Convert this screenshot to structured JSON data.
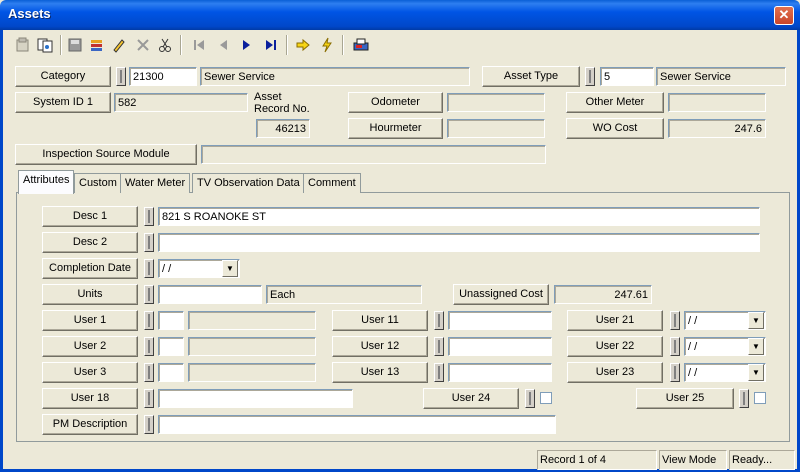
{
  "window": {
    "title": "Assets",
    "close_glyph": "✕"
  },
  "toolbar": {
    "icons": [
      "properties-icon",
      "copy-record-icon",
      "save-icon",
      "stack-icon",
      "edit-pencil-icon",
      "delete-icon",
      "cut-icon",
      "first-record-icon",
      "previous-record-icon",
      "next-record-icon",
      "last-record-icon",
      "goto-arrow-icon",
      "lightning-icon",
      "print-report-icon"
    ]
  },
  "header": {
    "category_label": "Category",
    "category_code": "21300",
    "category_name": "Sewer Service",
    "asset_type_label": "Asset Type",
    "asset_type_code": "5",
    "asset_type_name": "Sewer Service",
    "system_id_label": "System ID 1",
    "system_id_value": "582",
    "asset_record_label_1": "Asset",
    "asset_record_label_2": "Record No.",
    "asset_record_value": "46213",
    "odometer_label": "Odometer",
    "odometer_value": "",
    "other_meter_label": "Other Meter",
    "other_meter_value": "",
    "hourmeter_label": "Hourmeter",
    "hourmeter_value": "",
    "wo_cost_label": "WO Cost",
    "wo_cost_value": "247.6",
    "inspection_label": "Inspection Source Module",
    "inspection_value": ""
  },
  "tabs": [
    {
      "label": "Attributes",
      "active": true
    },
    {
      "label": "Custom"
    },
    {
      "label": "Water Meter"
    },
    {
      "label": "TV Observation Data"
    },
    {
      "label": "Comment"
    }
  ],
  "attributes": {
    "desc1_label": "Desc 1",
    "desc1_value": "821 S ROANOKE ST",
    "desc2_label": "Desc 2",
    "desc2_value": "",
    "completion_label": "Completion Date",
    "completion_value": " /  /",
    "units_label": "Units",
    "units_value": "",
    "units_each": "Each",
    "unassigned_label": "Unassigned Cost",
    "unassigned_value": "247.61",
    "user1_label": "User 1",
    "user2_label": "User 2",
    "user3_label": "User 3",
    "user11_label": "User 11",
    "user12_label": "User 12",
    "user13_label": "User 13",
    "user21_label": "User 21",
    "user21_value": " /  /",
    "user22_label": "User 22",
    "user22_value": " /  /",
    "user23_label": "User 23",
    "user23_value": " /  /",
    "user18_label": "User 18",
    "user24_label": "User 24",
    "user25_label": "User 25",
    "pm_label": "PM Description",
    "pm_value": ""
  },
  "status": {
    "record": "Record 1 of 4",
    "mode": "View Mode",
    "state": "Ready..."
  }
}
